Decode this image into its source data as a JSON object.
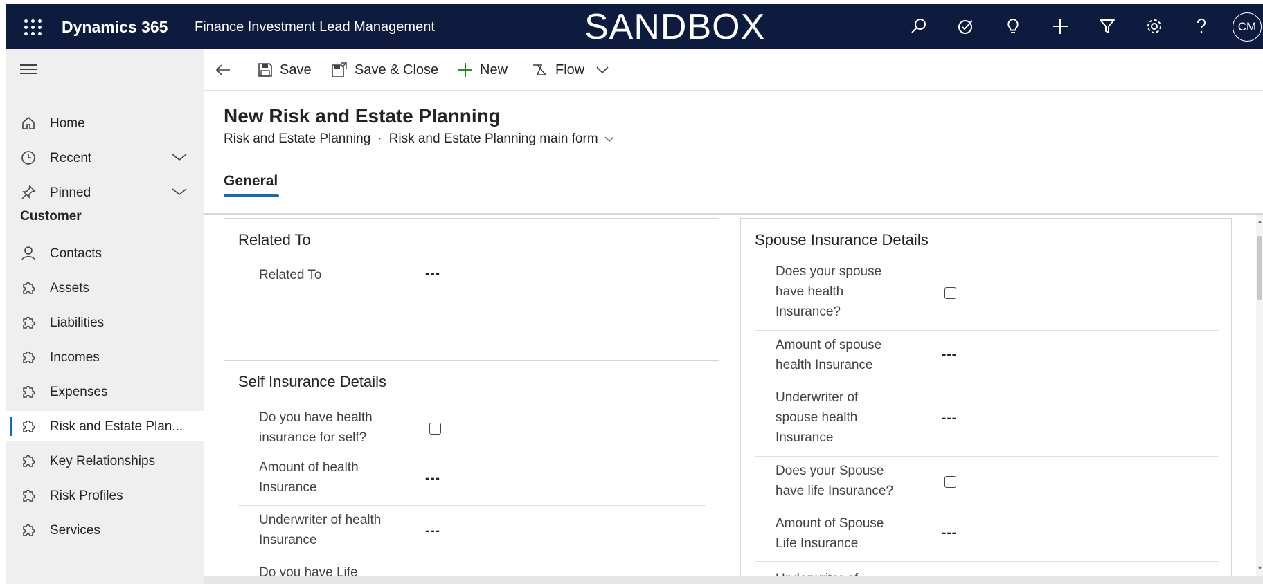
{
  "topbar": {
    "brand": "Dynamics 365",
    "app_name": "Finance Investment Lead Management",
    "environment": "SANDBOX",
    "avatar_initials": "CM",
    "bg_color": "#0d1b3e"
  },
  "sidebar": {
    "section_label": "Customer",
    "items": [
      {
        "label": "Home",
        "icon": "home-icon"
      },
      {
        "label": "Recent",
        "icon": "clock-icon"
      },
      {
        "label": "Pinned",
        "icon": "pin-icon"
      },
      {
        "label": "Contacts",
        "icon": "person-icon"
      },
      {
        "label": "Assets",
        "icon": "puzzle-icon"
      },
      {
        "label": "Liabilities",
        "icon": "puzzle-icon"
      },
      {
        "label": "Incomes",
        "icon": "puzzle-icon"
      },
      {
        "label": "Expenses",
        "icon": "puzzle-icon"
      },
      {
        "label": "Risk and Estate Plan...",
        "icon": "puzzle-icon"
      },
      {
        "label": "Key Relationships",
        "icon": "puzzle-icon"
      },
      {
        "label": "Risk Profiles",
        "icon": "puzzle-icon"
      },
      {
        "label": "Services",
        "icon": "puzzle-icon"
      }
    ]
  },
  "commandbar": {
    "save": "Save",
    "save_close": "Save & Close",
    "new": "New",
    "flow": "Flow"
  },
  "form": {
    "title": "New Risk and Estate Planning",
    "entity": "Risk and Estate Planning",
    "form_name": "Risk and Estate Planning main form",
    "tabs": [
      "General"
    ]
  },
  "sections": {
    "related_to": {
      "title": "Related To",
      "fields": [
        {
          "label": "Related To",
          "value": "---"
        }
      ]
    },
    "self_insurance": {
      "title": "Self Insurance Details",
      "fields": [
        {
          "label_lines": [
            "Do you have health",
            "insurance for self?"
          ],
          "type": "checkbox"
        },
        {
          "label_lines": [
            "Amount of health",
            "Insurance"
          ],
          "value": "---"
        },
        {
          "label_lines": [
            "Underwriter of health",
            "Insurance"
          ],
          "value": "---"
        },
        {
          "label_lines": [
            "Do you have Life"
          ]
        }
      ]
    },
    "spouse_insurance": {
      "title": "Spouse Insurance Details",
      "fields": [
        {
          "label_lines": [
            "Does your spouse",
            "have health",
            "Insurance?"
          ],
          "type": "checkbox"
        },
        {
          "label_lines": [
            "Amount of spouse",
            "health Insurance"
          ],
          "value": "---"
        },
        {
          "label_lines": [
            "Underwriter of",
            "spouse health",
            "Insurance"
          ],
          "value": "---"
        },
        {
          "label_lines": [
            "Does your Spouse",
            "have life Insurance?"
          ],
          "type": "checkbox"
        },
        {
          "label_lines": [
            "Amount of Spouse",
            "Life Insurance"
          ],
          "value": "---"
        },
        {
          "label_lines": [
            "Underwriter of"
          ]
        }
      ]
    }
  },
  "colors": {
    "accent": "#0f6cbd",
    "new_icon": "#107c10"
  }
}
